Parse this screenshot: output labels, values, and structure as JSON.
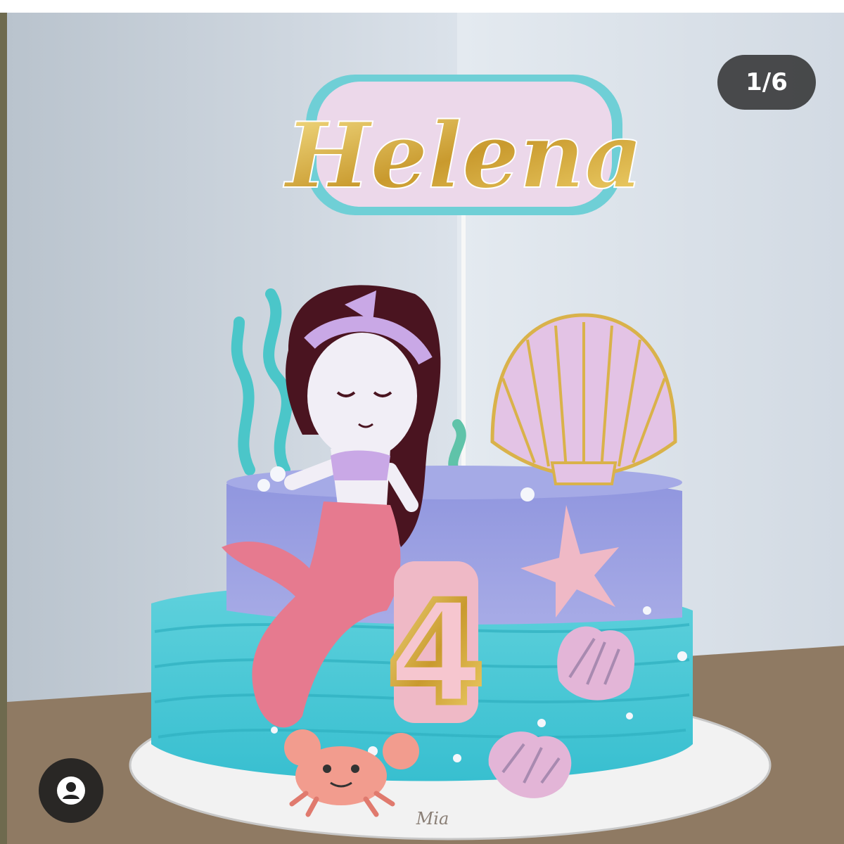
{
  "viewer": {
    "counter": "1/6",
    "user_tag_icon": "user-tag-icon"
  },
  "photo": {
    "topper_name": "Helena",
    "age_number": "4",
    "baker_mark": "Mia"
  },
  "colors": {
    "wall": "#cdd6df",
    "table": "#8f7a63",
    "cake_top": "#9aa0e0",
    "cake_bottom": "#4cc8d6",
    "tail": "#e07a90",
    "shell": "#e6c6e6",
    "gold": "#d9b24a"
  }
}
